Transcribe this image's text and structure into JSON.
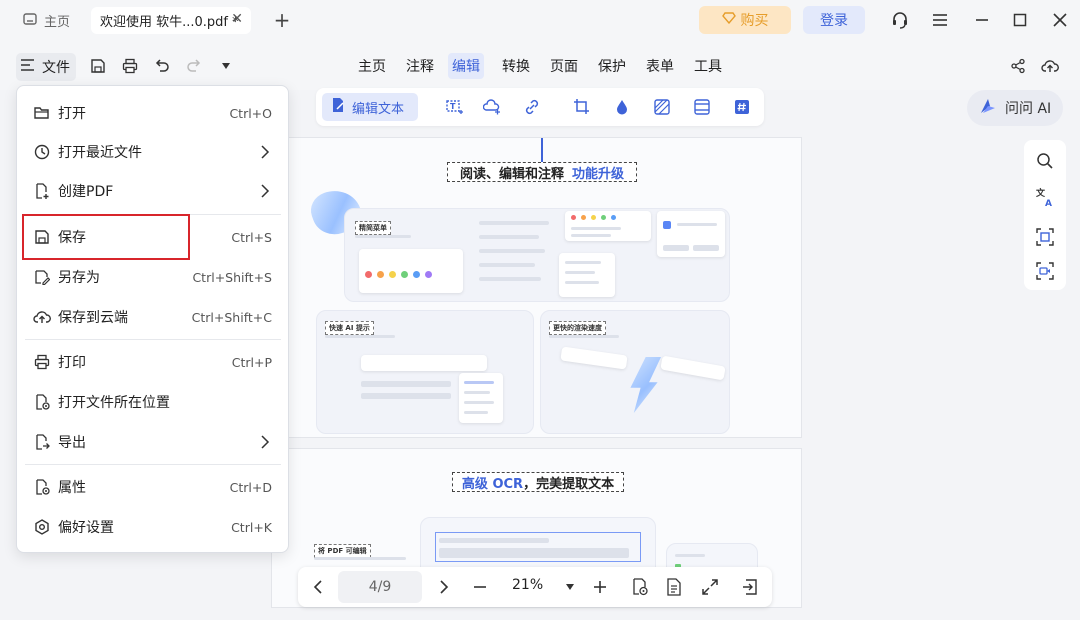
{
  "titlebar": {
    "home_tab": "主页",
    "doc_tab": "欢迎使用 软牛...0.pdf *",
    "close_tab": "✕",
    "add_tab": "+",
    "buy_label": "购买",
    "login_label": "登录"
  },
  "toolbar": {
    "file_label": "文件",
    "tabs": [
      "主页",
      "注释",
      "编辑",
      "转换",
      "页面",
      "保护",
      "表单",
      "工具"
    ],
    "active_tab": "编辑"
  },
  "ribbon": {
    "edit_text_label": "编辑文本"
  },
  "ask_ai_label": "问问 AI",
  "file_menu": {
    "items": [
      {
        "label": "打开",
        "shortcut": "Ctrl+O",
        "icon": "folder-open-icon"
      },
      {
        "label": "打开最近文件",
        "shortcut": "",
        "icon": "clock-icon",
        "submenu": true
      },
      {
        "label": "创建PDF",
        "shortcut": "",
        "icon": "create-pdf-icon",
        "submenu": true
      },
      {
        "label": "保存",
        "shortcut": "Ctrl+S",
        "icon": "save-icon"
      },
      {
        "label": "另存为",
        "shortcut": "Ctrl+Shift+S",
        "icon": "save-as-icon"
      },
      {
        "label": "保存到云端",
        "shortcut": "Ctrl+Shift+C",
        "icon": "cloud-upload-icon"
      },
      {
        "label": "打印",
        "shortcut": "Ctrl+P",
        "icon": "printer-icon"
      },
      {
        "label": "打开文件所在位置",
        "shortcut": "",
        "icon": "folder-location-icon"
      },
      {
        "label": "导出",
        "shortcut": "",
        "icon": "export-icon",
        "submenu": true
      },
      {
        "label": "属性",
        "shortcut": "Ctrl+D",
        "icon": "properties-icon"
      },
      {
        "label": "偏好设置",
        "shortcut": "Ctrl+K",
        "icon": "settings-icon"
      }
    ],
    "highlighted": "保存"
  },
  "page1": {
    "heading": "阅读、编辑和注释",
    "heading_highlight": "功能升级",
    "card1_label": "精简菜单",
    "card2_label": "快速 AI 提示",
    "card3_label": "更快的渲染速度"
  },
  "page2": {
    "heading_highlight": "高级 OCR",
    "heading": "，完美提取文本",
    "card_label": "将 PDF 可编辑"
  },
  "bottombar": {
    "page_indicator": "4/9",
    "zoom": "21%"
  },
  "colors": {
    "accent": "#3e63d8",
    "buy_bg": "#fde6c4",
    "buy_fg": "#e69d2a",
    "highlight_red": "#d8252b"
  }
}
